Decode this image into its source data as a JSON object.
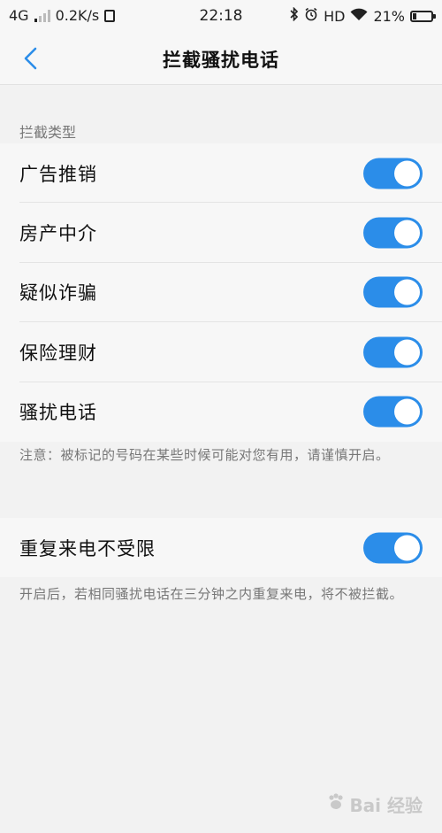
{
  "status_bar": {
    "network": "4G",
    "speed": "0.2K/s",
    "time": "22:18",
    "hd": "HD",
    "battery": "21%",
    "battery_level": 0.21
  },
  "nav": {
    "title": "拦截骚扰电话"
  },
  "section": {
    "title": "拦截类型"
  },
  "items": [
    {
      "label": "广告推销",
      "on": true
    },
    {
      "label": "房产中介",
      "on": true
    },
    {
      "label": "疑似诈骗",
      "on": true
    },
    {
      "label": "保险理财",
      "on": true
    },
    {
      "label": "骚扰电话",
      "on": true
    }
  ],
  "note1": "注意：被标记的号码在某些时候可能对您有用，请谨慎开启。",
  "repeat": {
    "label": "重复来电不受限",
    "on": true
  },
  "note2": "开启后，若相同骚扰电话在三分钟之内重复来电，将不被拦截。",
  "watermark": "Bai 经验",
  "colors": {
    "accent": "#2b8de9"
  }
}
